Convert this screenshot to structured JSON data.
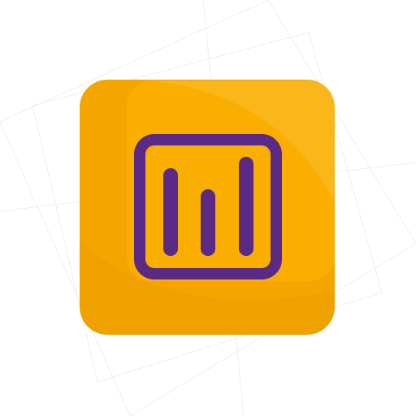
{
  "app_icon": {
    "icon": "bar-chart-icon",
    "colors": {
      "tile_base": "#F4A500",
      "tile_highlight": "#FFB800",
      "tile_shade": "#E69A00",
      "glyph": "#5B2A86",
      "background": "#FFFFFF",
      "background_lines": "#EEEEEE"
    }
  }
}
